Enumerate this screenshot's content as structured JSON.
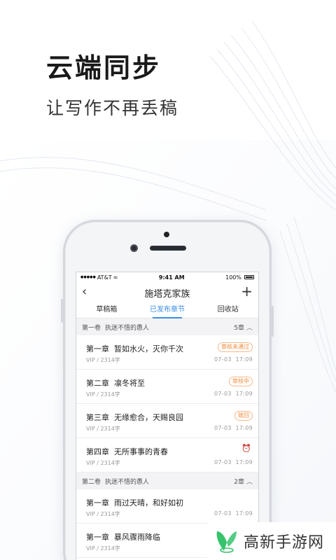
{
  "promo": {
    "headline": "云端同步",
    "subline": "让写作不再丢稿"
  },
  "status_bar": {
    "signal": "●●●●●",
    "carrier": "AT&T",
    "wifi": "≈",
    "time": "9:41 AM",
    "battery": "100%"
  },
  "nav": {
    "back_icon": "‹",
    "title": "施塔克家族",
    "add_icon": "+"
  },
  "tabs": [
    "草稿箱",
    "已发布章节",
    "回收站"
  ],
  "volumes": [
    {
      "name": "第一卷",
      "subtitle": "执迷不悟的愚人",
      "count": "5章",
      "chapters": [
        {
          "num": "第一章",
          "title": "暂如水火，灭你千次",
          "meta": "VIP / 2314字",
          "date": "07-03",
          "time": "17:09",
          "badge": "审核未通过"
        },
        {
          "num": "第二章",
          "title": "凛冬将至",
          "meta": "VIP / 2314字",
          "date": "07-03",
          "time": "17:09",
          "badge": "审核中"
        },
        {
          "num": "第三章",
          "title": "无缘愈合，天赐良园",
          "meta": "VIP / 2314字",
          "date": "07-03",
          "time": "17:09",
          "badge": "赎回"
        },
        {
          "num": "第四章",
          "title": "无所事事的青春",
          "meta": "VIP / 2314字",
          "date": "07-03",
          "time": "17:09",
          "badge": ""
        }
      ]
    },
    {
      "name": "第二卷",
      "subtitle": "执迷不悟的愚人",
      "count": "2章",
      "chapters": [
        {
          "num": "第一章",
          "title": "雨过天晴，和好如初",
          "meta": "VIP / 2314字",
          "date": "07-03",
          "time": "17:09",
          "badge": ""
        },
        {
          "num": "第一章",
          "title": "暴风骤雨降临",
          "meta": "VIP / 2314字",
          "date": "",
          "time": "",
          "badge": ""
        }
      ]
    }
  ],
  "watermark": {
    "text": "高新手游网"
  },
  "colors": {
    "accent": "#3a8ee6",
    "badge": "#f08a3c",
    "logo_green": "#36c36b"
  }
}
